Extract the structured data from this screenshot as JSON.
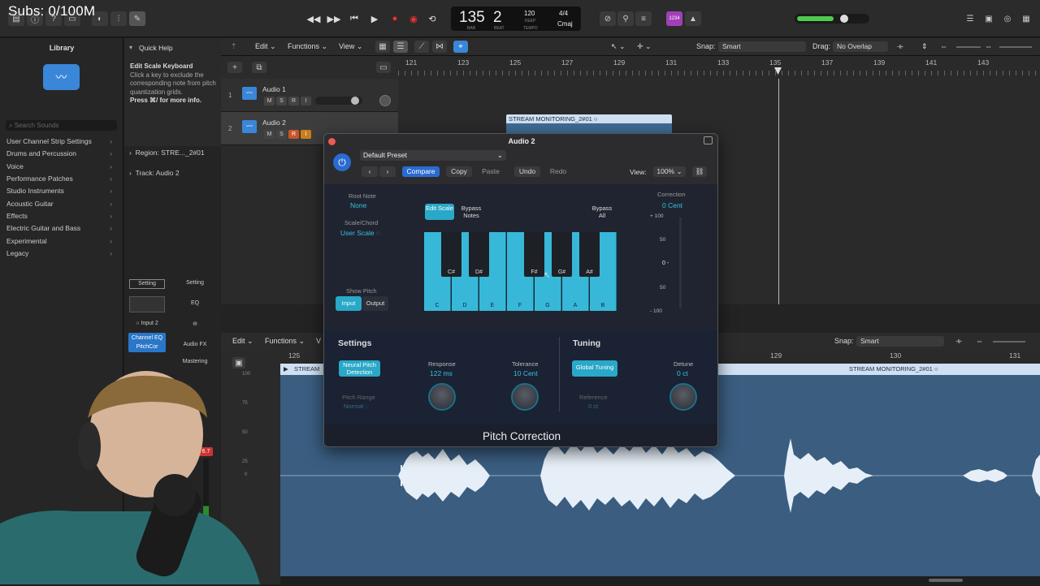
{
  "overlay": {
    "subs": "Subs: 0/100M"
  },
  "lcd": {
    "bar": "135",
    "beat": "2",
    "bar_lbl": "BAR",
    "beat_lbl": "BEAT",
    "tempo": "120",
    "keep": "KEEP",
    "tempo_lbl": "TEMPO",
    "sig": "4/4",
    "key": "Cmaj"
  },
  "topbar": {
    "count_badge": "1234"
  },
  "library": {
    "title": "Library",
    "search_placeholder": "Search Sounds",
    "items": [
      "User Channel Strip Settings",
      "Drums and Percussion",
      "Voice",
      "Performance Patches",
      "Studio Instruments",
      "Acoustic Guitar",
      "Effects",
      "Electric Guitar and Bass",
      "Experimental",
      "Legacy"
    ]
  },
  "quick_help": {
    "title": "Quick Help",
    "heading": "Edit Scale Keyboard",
    "body": "Click a key to exclude the corresponding note from pitch quantization grids.",
    "more": "Press ⌘/ for more info."
  },
  "inspector": {
    "region": "Region: STRE..._2#01",
    "track": "Track: Audio 2",
    "setting1": "Setting",
    "setting2": "Setting",
    "eq": "EQ",
    "input": "Input 2",
    "channel_eq": "Channel EQ",
    "pitchcor": "PitchCor",
    "audio_fx": "Audio FX",
    "mastering": "Mastering",
    "meter_val": "6.7"
  },
  "tracks_toolbar": {
    "edit": "Edit",
    "functions": "Functions",
    "view": "View",
    "snap_lbl": "Snap:",
    "snap_val": "Smart",
    "drag_lbl": "Drag:",
    "drag_val": "No Overlap"
  },
  "ruler": [
    "121",
    "123",
    "125",
    "127",
    "129",
    "131",
    "133",
    "135",
    "137",
    "139",
    "141",
    "143"
  ],
  "tracks": [
    {
      "num": "1",
      "name": "Audio 1"
    },
    {
      "num": "2",
      "name": "Audio 2"
    }
  ],
  "region": {
    "label": "STREAM MONITORING_2#01"
  },
  "editor": {
    "edit": "Edit",
    "functions": "Functions",
    "view": "V",
    "snap_lbl": "Snap:",
    "snap_val": "Smart",
    "ruler": [
      "125",
      "129",
      "130",
      "131"
    ],
    "region_label": "STREAM MONITORING_2#01",
    "region_label2": "STREAM",
    "y_ticks": [
      "100",
      "75",
      "50",
      "25",
      "0"
    ]
  },
  "plugin": {
    "title": "Audio 2",
    "preset": "Default Preset",
    "compare": "Compare",
    "copy": "Copy",
    "paste": "Paste",
    "undo": "Undo",
    "redo": "Redo",
    "view_lbl": "View:",
    "view_val": "100%",
    "root_note_lbl": "Root Note",
    "root_note_val": "None",
    "scale_lbl": "Scale/Chord",
    "scale_val": "User Scale",
    "show_pitch_lbl": "Show Pitch",
    "input_btn": "Input",
    "output_btn": "Output",
    "edit_scale": "Edit Scale",
    "bypass_notes": "Bypass Notes",
    "bypass_all": "Bypass All",
    "white_keys": [
      "C",
      "D",
      "E",
      "F",
      "G",
      "A",
      "B"
    ],
    "black_keys": [
      "C#",
      "D#",
      "F#",
      "G#",
      "A#"
    ],
    "correction_lbl": "Correction",
    "correction_val": "0 Cent",
    "meter_ticks": [
      "+ 100",
      "50",
      "0 -",
      "50",
      "- 100"
    ],
    "settings_title": "Settings",
    "tuning_title": "Tuning",
    "neural": "Neural Pitch Detection",
    "pitch_range_lbl": "Pitch Range",
    "pitch_range_val": "Normal",
    "response_lbl": "Response",
    "response_val": "122 ms",
    "tolerance_lbl": "Tolerance",
    "tolerance_val": "10 Cent",
    "global_tuning": "Global Tuning",
    "reference_lbl": "Reference",
    "reference_val": "0 ct",
    "detune_lbl": "Detune",
    "detune_val": "0 ct",
    "footer": "Pitch Correction"
  }
}
